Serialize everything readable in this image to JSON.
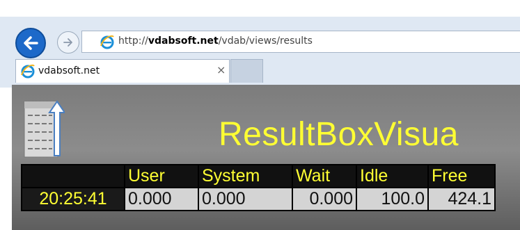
{
  "browser": {
    "url_host": "vdabsoft.net",
    "url_prefix": "http://",
    "url_path": "/vdab/views/results",
    "tab_title": "vdabsoft.net",
    "tab_close": "×",
    "accent_color": "#1d69c9",
    "icons": [
      "back-arrow-icon",
      "forward-arrow-icon",
      "ie-logo-icon",
      "close-icon"
    ]
  },
  "app": {
    "title": "ResultBoxVisua",
    "title_color": "#ffff33",
    "icon": "document-upload-icon"
  },
  "results": {
    "headers": [
      "",
      "User",
      "System",
      "Wait",
      "Idle",
      "Free"
    ],
    "row": {
      "time": "20:25:41",
      "user": "0.000",
      "system": "0.000",
      "wait": "0.000",
      "idle": "100.0",
      "free": "424.1"
    }
  }
}
